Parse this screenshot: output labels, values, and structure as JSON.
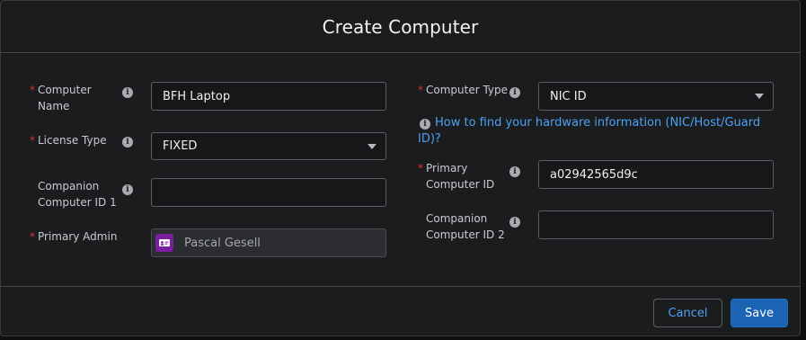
{
  "dialog": {
    "title": "Create Computer"
  },
  "form": {
    "computer_name": {
      "label": "Computer Name",
      "value": "BFH Laptop",
      "required": true
    },
    "license_type": {
      "label": "License Type",
      "value": "FIXED",
      "required": true
    },
    "companion_id_1": {
      "label": "Companion Computer ID 1",
      "value": "",
      "required": false
    },
    "primary_admin": {
      "label": "Primary Admin",
      "value": "Pascal Gesell",
      "required": true
    },
    "computer_type": {
      "label": "Computer Type",
      "value": "NIC ID",
      "required": true
    },
    "help_link": "How to find your hardware information (NIC/Host/Guard ID)?",
    "primary_computer_id": {
      "label": "Primary Computer ID",
      "value": "a02942565d9c",
      "required": true
    },
    "companion_id_2": {
      "label": "Companion Computer ID 2",
      "value": "",
      "required": false
    }
  },
  "icons": {
    "info": "info-icon",
    "dropdown": "chevron-down-icon",
    "avatar": "contact-card-icon"
  },
  "footer": {
    "cancel_label": "Cancel",
    "save_label": "Save"
  },
  "colors": {
    "background": "#1b1c1e",
    "required": "#e3303b",
    "link": "#4ea1f3",
    "primary_button": "#1b63b3",
    "avatar": "#7b1fa2"
  }
}
